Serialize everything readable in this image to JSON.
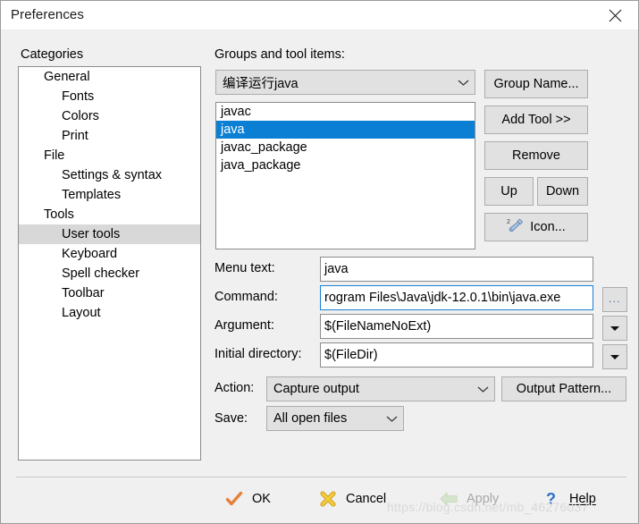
{
  "window": {
    "title": "Preferences",
    "close_icon": "close-icon"
  },
  "categories": {
    "label": "Categories",
    "items": [
      {
        "label": "General",
        "level": 0,
        "selected": false
      },
      {
        "label": "Fonts",
        "level": 1,
        "selected": false
      },
      {
        "label": "Colors",
        "level": 1,
        "selected": false
      },
      {
        "label": "Print",
        "level": 1,
        "selected": false
      },
      {
        "label": "File",
        "level": 0,
        "selected": false
      },
      {
        "label": "Settings & syntax",
        "level": 1,
        "selected": false
      },
      {
        "label": "Templates",
        "level": 1,
        "selected": false
      },
      {
        "label": "Tools",
        "level": 0,
        "selected": false
      },
      {
        "label": "User tools",
        "level": 1,
        "selected": true
      },
      {
        "label": "Keyboard",
        "level": 1,
        "selected": false
      },
      {
        "label": "Spell checker",
        "level": 1,
        "selected": false
      },
      {
        "label": "Toolbar",
        "level": 1,
        "selected": false
      },
      {
        "label": "Layout",
        "level": 1,
        "selected": false
      }
    ]
  },
  "groups": {
    "label": "Groups and tool items:",
    "selected_group": "编译运行java",
    "group_options": [
      "编译运行java"
    ],
    "tools": [
      {
        "label": "javac",
        "selected": false
      },
      {
        "label": "java",
        "selected": true
      },
      {
        "label": "javac_package",
        "selected": false
      },
      {
        "label": "java_package",
        "selected": false
      }
    ]
  },
  "side_buttons": {
    "group_name": "Group Name...",
    "add_tool": "Add Tool >>",
    "remove": "Remove",
    "up": "Up",
    "down": "Down",
    "icon": "Icon...",
    "icon_glyph": "screwdriver-icon"
  },
  "form": {
    "menu_text": {
      "label": "Menu text:",
      "value": "java"
    },
    "command": {
      "label": "Command:",
      "value": "rogram Files\\Java\\jdk-12.0.1\\bin\\java.exe",
      "focused": true,
      "browse_button": "..."
    },
    "argument": {
      "label": "Argument:",
      "value": "$(FileNameNoExt)"
    },
    "initial_directory": {
      "label": "Initial directory:",
      "value": "$(FileDir)"
    },
    "action": {
      "label": "Action:",
      "value": "Capture output",
      "options": [
        "Capture output"
      ],
      "output_pattern_button": "Output Pattern..."
    },
    "save": {
      "label": "Save:",
      "value": "All open files",
      "options": [
        "All open files"
      ]
    }
  },
  "footer": {
    "ok": "OK",
    "cancel": "Cancel",
    "apply": "Apply",
    "help": "Help",
    "apply_enabled": false,
    "watermark": "https://blog.csdn.net/mb_46276037"
  },
  "colors": {
    "selection_blue": "#0a7fd4",
    "focus_border": "#1a7fd4",
    "dialog_bg": "#f0f0f0",
    "button_bg": "#e1e1e1",
    "tree_selection": "#d8d8d8",
    "ok_icon": "#e8803a",
    "cancel_icon": "#f0c020",
    "help_icon": "#2a6fc9"
  }
}
